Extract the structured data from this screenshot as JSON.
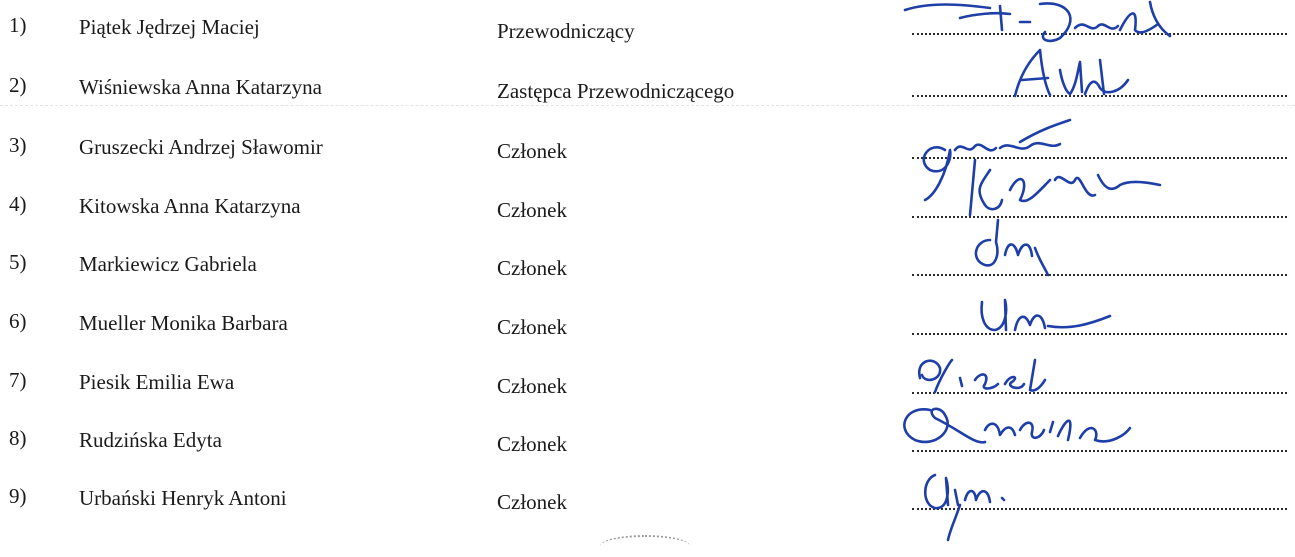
{
  "members": [
    {
      "number": "1)",
      "name": "Piątek Jędrzej Maciej",
      "role": "Przewodniczący"
    },
    {
      "number": "2)",
      "name": "Wiśniewska Anna Katarzyna",
      "role": "Zastępca Przewodniczącego"
    },
    {
      "number": "3)",
      "name": "Gruszecki Andrzej Sławomir",
      "role": "Członek"
    },
    {
      "number": "4)",
      "name": "Kitowska Anna Katarzyna",
      "role": "Członek"
    },
    {
      "number": "5)",
      "name": "Markiewicz Gabriela",
      "role": "Członek"
    },
    {
      "number": "6)",
      "name": "Mueller Monika Barbara",
      "role": "Członek"
    },
    {
      "number": "7)",
      "name": "Piesik Emilia Ewa",
      "role": "Członek"
    },
    {
      "number": "8)",
      "name": "Rudzińska Edyta",
      "role": "Członek"
    },
    {
      "number": "9)",
      "name": "Urbański Henryk Antoni",
      "role": "Członek"
    }
  ],
  "colors": {
    "text": "#1a1a1a",
    "signature_ink": "#1f3fa8",
    "dotted_line": "#2b2b2b"
  }
}
